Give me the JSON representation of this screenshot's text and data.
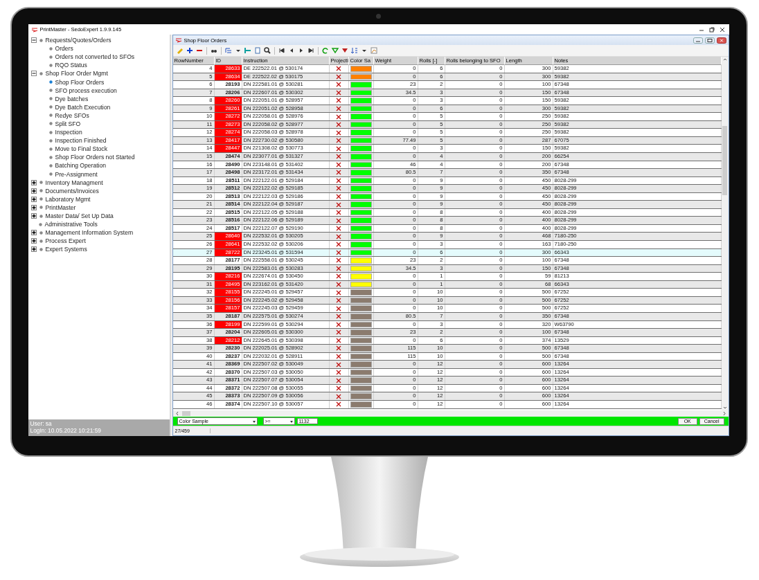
{
  "window": {
    "title": "PrintMaster - SedoExpert 1.9.9.145"
  },
  "tree": [
    {
      "label": "Requests/Quotes/Orders",
      "expanded": true,
      "selected": false,
      "children": [
        {
          "label": "Orders",
          "selected": false
        },
        {
          "label": "Orders not converted to SFOs",
          "selected": false
        },
        {
          "label": "RQO Status",
          "selected": false
        }
      ]
    },
    {
      "label": "Shop Floor Order Mgmt",
      "expanded": true,
      "selected": false,
      "children": [
        {
          "label": "Shop Floor Orders",
          "selected": true
        },
        {
          "label": "SFO process execution",
          "selected": false
        },
        {
          "label": "Dye batches",
          "selected": false
        },
        {
          "label": "Dye Batch Execution",
          "selected": false
        },
        {
          "label": "Redye SFOs",
          "selected": false
        },
        {
          "label": "Split SFO",
          "selected": false
        },
        {
          "label": "Inspection",
          "selected": false
        },
        {
          "label": "Inspection Finished",
          "selected": false
        },
        {
          "label": "Move to Final Stock",
          "selected": false
        },
        {
          "label": "Shop Floor Orders not Started",
          "selected": false
        },
        {
          "label": "Batching Operation",
          "selected": false
        },
        {
          "label": "Pre-Assignment",
          "selected": false
        }
      ]
    },
    {
      "label": "Inventory Managment",
      "expanded": false,
      "selected": false
    },
    {
      "label": "Documents/Invoices",
      "expanded": false,
      "selected": false
    },
    {
      "label": "Laboratory Mgmt",
      "expanded": false,
      "selected": false
    },
    {
      "label": "PrintMaster",
      "expanded": false,
      "selected": false
    },
    {
      "label": "Master Data/ Set Up Data",
      "expanded": false,
      "selected": false
    },
    {
      "label": "Administrative Tools",
      "selected": false
    },
    {
      "label": "Management Information System",
      "expanded": false,
      "selected": false
    },
    {
      "label": "Process Expert",
      "expanded": false,
      "selected": false
    },
    {
      "label": "Expert Systems",
      "expanded": false,
      "selected": false
    }
  ],
  "user": {
    "user": "User: sa",
    "login": "LogIn: 10.05.2022 10:21:59"
  },
  "child_window": {
    "title": "Shop Floor Orders"
  },
  "columns": [
    "RowNumber",
    "ID",
    "Instruction",
    "Projecti",
    "Color Sa",
    "Weight",
    "Rolls [-]",
    "Rolls belonging to SFO",
    "Length",
    "Notes"
  ],
  "rows": [
    {
      "row": "4",
      "id": "28633",
      "flagged": true,
      "instruction": "DE 222522.01 @ 530174",
      "projection": false,
      "color": "#ff8000",
      "weight": "0",
      "rolls": "6",
      "rolls_sfo": "0",
      "length": "300",
      "notes": "59382",
      "selected": false
    },
    {
      "row": "5",
      "id": "28634",
      "flagged": true,
      "instruction": "DE 222522.02 @ 530175",
      "projection": false,
      "color": "#ff8000",
      "weight": "0",
      "rolls": "6",
      "rolls_sfo": "0",
      "length": "300",
      "notes": "59382",
      "selected": false
    },
    {
      "row": "6",
      "id": "28193",
      "flagged": false,
      "instruction": "DN 222581.01 @ 530281",
      "projection": false,
      "color": "#00ff00",
      "weight": "23",
      "rolls": "2",
      "rolls_sfo": "0",
      "length": "100",
      "notes": "67348",
      "selected": false
    },
    {
      "row": "7",
      "id": "28206",
      "flagged": false,
      "instruction": "DN 222607.01 @ 530302",
      "projection": false,
      "color": "#00ff00",
      "weight": "34.5",
      "rolls": "3",
      "rolls_sfo": "0",
      "length": "150",
      "notes": "67348",
      "selected": false
    },
    {
      "row": "8",
      "id": "28260",
      "flagged": true,
      "instruction": "DN 222051.01 @ 528957",
      "projection": false,
      "color": "#00ff00",
      "weight": "0",
      "rolls": "3",
      "rolls_sfo": "0",
      "length": "150",
      "notes": "59382",
      "selected": false
    },
    {
      "row": "9",
      "id": "28261",
      "flagged": true,
      "instruction": "DN 222051.02 @ 528958",
      "projection": false,
      "color": "#00ff00",
      "weight": "0",
      "rolls": "6",
      "rolls_sfo": "0",
      "length": "300",
      "notes": "59382",
      "selected": false
    },
    {
      "row": "10",
      "id": "28272",
      "flagged": true,
      "instruction": "DN 222058.01 @ 528976",
      "projection": false,
      "color": "#00ff00",
      "weight": "0",
      "rolls": "5",
      "rolls_sfo": "0",
      "length": "250",
      "notes": "59382",
      "selected": false
    },
    {
      "row": "11",
      "id": "28273",
      "flagged": true,
      "instruction": "DN 222058.02 @ 528977",
      "projection": false,
      "color": "#00ff00",
      "weight": "0",
      "rolls": "5",
      "rolls_sfo": "0",
      "length": "250",
      "notes": "59382",
      "selected": false
    },
    {
      "row": "12",
      "id": "28274",
      "flagged": true,
      "instruction": "DN 222058.03 @ 528978",
      "projection": false,
      "color": "#00ff00",
      "weight": "0",
      "rolls": "5",
      "rolls_sfo": "0",
      "length": "250",
      "notes": "59382",
      "selected": false
    },
    {
      "row": "13",
      "id": "28417",
      "flagged": true,
      "instruction": "DN 222730.02 @ 530580",
      "projection": false,
      "color": "#00ff00",
      "weight": "77.49",
      "rolls": "5",
      "rolls_sfo": "0",
      "length": "287",
      "notes": "67075",
      "selected": false
    },
    {
      "row": "14",
      "id": "28447",
      "flagged": true,
      "instruction": "DN 221308.02 @ 530773",
      "projection": false,
      "color": "#00ff00",
      "weight": "0",
      "rolls": "3",
      "rolls_sfo": "0",
      "length": "150",
      "notes": "59382",
      "selected": false
    },
    {
      "row": "15",
      "id": "28474",
      "flagged": false,
      "instruction": "DN 223077.01 @ 531327",
      "projection": false,
      "color": "#00ff00",
      "weight": "0",
      "rolls": "4",
      "rolls_sfo": "0",
      "length": "200",
      "notes": "66254",
      "selected": false
    },
    {
      "row": "16",
      "id": "28490",
      "flagged": false,
      "instruction": "DN 223148.01 @ 531402",
      "projection": false,
      "color": "#00ff00",
      "weight": "46",
      "rolls": "4",
      "rolls_sfo": "0",
      "length": "200",
      "notes": "67348",
      "selected": false
    },
    {
      "row": "17",
      "id": "28498",
      "flagged": false,
      "instruction": "DN 223172.01 @ 531434",
      "projection": false,
      "color": "#00ff00",
      "weight": "80.5",
      "rolls": "7",
      "rolls_sfo": "0",
      "length": "350",
      "notes": "67348",
      "selected": false
    },
    {
      "row": "18",
      "id": "28511",
      "flagged": false,
      "instruction": "DN 222122.01 @ 529184",
      "projection": false,
      "color": "#00ff00",
      "weight": "0",
      "rolls": "9",
      "rolls_sfo": "0",
      "length": "450",
      "notes": "8028-299",
      "selected": false
    },
    {
      "row": "19",
      "id": "28512",
      "flagged": false,
      "instruction": "DN 222122.02 @ 529185",
      "projection": false,
      "color": "#00ff00",
      "weight": "0",
      "rolls": "9",
      "rolls_sfo": "0",
      "length": "450",
      "notes": "8028-299",
      "selected": false
    },
    {
      "row": "20",
      "id": "28513",
      "flagged": false,
      "instruction": "DN 222122.03 @ 529186",
      "projection": false,
      "color": "#00ff00",
      "weight": "0",
      "rolls": "9",
      "rolls_sfo": "0",
      "length": "450",
      "notes": "8028-299",
      "selected": false
    },
    {
      "row": "21",
      "id": "28514",
      "flagged": false,
      "instruction": "DN 222122.04 @ 529187",
      "projection": false,
      "color": "#00ff00",
      "weight": "0",
      "rolls": "9",
      "rolls_sfo": "0",
      "length": "450",
      "notes": "8028-299",
      "selected": false
    },
    {
      "row": "22",
      "id": "28515",
      "flagged": false,
      "instruction": "DN 222122.05 @ 529188",
      "projection": false,
      "color": "#00ff00",
      "weight": "0",
      "rolls": "8",
      "rolls_sfo": "0",
      "length": "400",
      "notes": "8028-299",
      "selected": false
    },
    {
      "row": "23",
      "id": "28516",
      "flagged": false,
      "instruction": "DN 222122.06 @ 529189",
      "projection": false,
      "color": "#00ff00",
      "weight": "0",
      "rolls": "8",
      "rolls_sfo": "0",
      "length": "400",
      "notes": "8028-299",
      "selected": false
    },
    {
      "row": "24",
      "id": "28517",
      "flagged": false,
      "instruction": "DN 222122.07 @ 529190",
      "projection": false,
      "color": "#00ff00",
      "weight": "0",
      "rolls": "8",
      "rolls_sfo": "0",
      "length": "400",
      "notes": "8028-299",
      "selected": false
    },
    {
      "row": "25",
      "id": "28640",
      "flagged": true,
      "instruction": "DN 222532.01 @ 530205",
      "projection": false,
      "color": "#00ff00",
      "weight": "0",
      "rolls": "9",
      "rolls_sfo": "0",
      "length": "468",
      "notes": "7180-250",
      "selected": false
    },
    {
      "row": "26",
      "id": "28641",
      "flagged": true,
      "instruction": "DN 222532.02 @ 530206",
      "projection": false,
      "color": "#00ff00",
      "weight": "0",
      "rolls": "3",
      "rolls_sfo": "0",
      "length": "163",
      "notes": "7180-250",
      "selected": false
    },
    {
      "row": "27",
      "id": "28722",
      "flagged": true,
      "instruction": "DN 223245.01 @ 531594",
      "projection": false,
      "color": "#00ff00",
      "weight": "0",
      "rolls": "6",
      "rolls_sfo": "0",
      "length": "300",
      "notes": "66343",
      "selected": true
    },
    {
      "row": "28",
      "id": "28177",
      "flagged": false,
      "instruction": "DN 222558.01 @ 530245",
      "projection": false,
      "color": "#ffff00",
      "weight": "23",
      "rolls": "2",
      "rolls_sfo": "0",
      "length": "100",
      "notes": "67348",
      "selected": false
    },
    {
      "row": "29",
      "id": "28195",
      "flagged": false,
      "instruction": "DN 222583.01 @ 530283",
      "projection": false,
      "color": "#ffff00",
      "weight": "34.5",
      "rolls": "3",
      "rolls_sfo": "0",
      "length": "150",
      "notes": "67348",
      "selected": false
    },
    {
      "row": "30",
      "id": "28216",
      "flagged": true,
      "instruction": "DN 222674.01 @ 530450",
      "projection": false,
      "color": "#ffff00",
      "weight": "0",
      "rolls": "1",
      "rolls_sfo": "0",
      "length": "59",
      "notes": "81213",
      "selected": false
    },
    {
      "row": "31",
      "id": "28495",
      "flagged": true,
      "instruction": "DN 223162.01 @ 531420",
      "projection": false,
      "color": "#ffff00",
      "weight": "0",
      "rolls": "1",
      "rolls_sfo": "0",
      "length": "68",
      "notes": "66343",
      "selected": false
    },
    {
      "row": "32",
      "id": "28155",
      "flagged": true,
      "instruction": "DN 222245.01 @ 529457",
      "projection": false,
      "color": "#8b7b6e",
      "weight": "0",
      "rolls": "10",
      "rolls_sfo": "0",
      "length": "500",
      "notes": "67252",
      "selected": false
    },
    {
      "row": "33",
      "id": "28156",
      "flagged": true,
      "instruction": "DN 222245.02 @ 529458",
      "projection": false,
      "color": "#8b7b6e",
      "weight": "0",
      "rolls": "10",
      "rolls_sfo": "0",
      "length": "500",
      "notes": "67252",
      "selected": false
    },
    {
      "row": "34",
      "id": "28157",
      "flagged": true,
      "instruction": "DN 222245.03 @ 529459",
      "projection": false,
      "color": "#8b7b6e",
      "weight": "0",
      "rolls": "10",
      "rolls_sfo": "0",
      "length": "500",
      "notes": "67252",
      "selected": false
    },
    {
      "row": "35",
      "id": "28187",
      "flagged": false,
      "instruction": "DN 222575.01 @ 530274",
      "projection": false,
      "color": "#8b7b6e",
      "weight": "80.5",
      "rolls": "7",
      "rolls_sfo": "0",
      "length": "350",
      "notes": "67348",
      "selected": false
    },
    {
      "row": "36",
      "id": "28199",
      "flagged": true,
      "instruction": "DN 222599.01 @ 530294",
      "projection": false,
      "color": "#8b7b6e",
      "weight": "0",
      "rolls": "3",
      "rolls_sfo": "0",
      "length": "320",
      "notes": "W63790",
      "selected": false
    },
    {
      "row": "37",
      "id": "28204",
      "flagged": false,
      "instruction": "DN 222605.01 @ 530300",
      "projection": false,
      "color": "#8b7b6e",
      "weight": "23",
      "rolls": "2",
      "rolls_sfo": "0",
      "length": "100",
      "notes": "67348",
      "selected": false
    },
    {
      "row": "38",
      "id": "28212",
      "flagged": true,
      "instruction": "DN 222645.01 @ 530398",
      "projection": false,
      "color": "#8b7b6e",
      "weight": "0",
      "rolls": "6",
      "rolls_sfo": "0",
      "length": "374",
      "notes": "13529",
      "selected": false
    },
    {
      "row": "39",
      "id": "28230",
      "flagged": false,
      "instruction": "DN 222025.01 @ 528902",
      "projection": false,
      "color": "#8b7b6e",
      "weight": "115",
      "rolls": "10",
      "rolls_sfo": "0",
      "length": "500",
      "notes": "67348",
      "selected": false
    },
    {
      "row": "40",
      "id": "28237",
      "flagged": false,
      "instruction": "DN 222032.01 @ 528911",
      "projection": false,
      "color": "#8b7b6e",
      "weight": "115",
      "rolls": "10",
      "rolls_sfo": "0",
      "length": "500",
      "notes": "67348",
      "selected": false
    },
    {
      "row": "41",
      "id": "28369",
      "flagged": false,
      "instruction": "DN 222507.02 @ 530049",
      "projection": false,
      "color": "#8b7b6e",
      "weight": "0",
      "rolls": "12",
      "rolls_sfo": "0",
      "length": "600",
      "notes": "13264",
      "selected": false
    },
    {
      "row": "42",
      "id": "28370",
      "flagged": false,
      "instruction": "DN 222507.03 @ 530050",
      "projection": false,
      "color": "#8b7b6e",
      "weight": "0",
      "rolls": "12",
      "rolls_sfo": "0",
      "length": "600",
      "notes": "13264",
      "selected": false
    },
    {
      "row": "43",
      "id": "28371",
      "flagged": false,
      "instruction": "DN 222507.07 @ 530054",
      "projection": false,
      "color": "#8b7b6e",
      "weight": "0",
      "rolls": "12",
      "rolls_sfo": "0",
      "length": "600",
      "notes": "13264",
      "selected": false
    },
    {
      "row": "44",
      "id": "28372",
      "flagged": false,
      "instruction": "DN 222507.08 @ 530055",
      "projection": false,
      "color": "#8b7b6e",
      "weight": "0",
      "rolls": "12",
      "rolls_sfo": "0",
      "length": "600",
      "notes": "13264",
      "selected": false
    },
    {
      "row": "45",
      "id": "28373",
      "flagged": false,
      "instruction": "DN 222507.09 @ 530056",
      "projection": false,
      "color": "#8b7b6e",
      "weight": "0",
      "rolls": "12",
      "rolls_sfo": "0",
      "length": "600",
      "notes": "13264",
      "selected": false
    },
    {
      "row": "46",
      "id": "28374",
      "flagged": false,
      "instruction": "DN 222507.10 @ 530057",
      "projection": false,
      "color": "#8b7b6e",
      "weight": "0",
      "rolls": "12",
      "rolls_sfo": "0",
      "length": "600",
      "notes": "13264",
      "selected": false
    }
  ],
  "filter": {
    "field": "Color Sample",
    "operator": ">=",
    "value": "1132",
    "buttons": [
      "OK",
      "Cancel"
    ]
  },
  "status_bar": {
    "position": "27/459"
  }
}
